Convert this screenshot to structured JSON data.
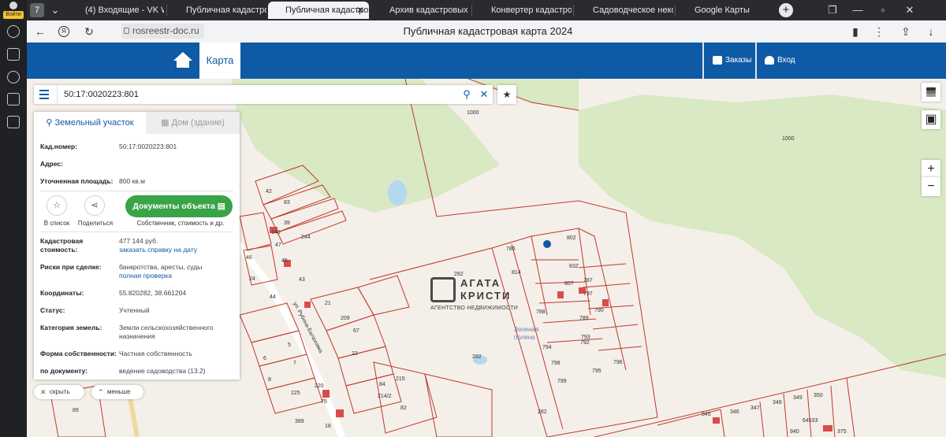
{
  "browser": {
    "user_button": "Войти",
    "tab_count": "7",
    "tabs": [
      {
        "label": "(4) Входящие - VK Wo",
        "color": "#2a7de1"
      },
      {
        "label": "Публичная кадастро",
        "color": "#45b96b"
      },
      {
        "label": "Публичная кадастро",
        "color": "#1976d2"
      },
      {
        "label": "Архив кадастровых п",
        "color": "#3f5fb5"
      },
      {
        "label": "Конвертер кадастров",
        "color": "#3f5fb5"
      },
      {
        "label": "Садоводческое неком",
        "color": "#e04436"
      },
      {
        "label": "Google Карты",
        "color": "#34a853"
      }
    ],
    "url": "rosreestr-doc.ru",
    "page_title": "Публичная кадастровая карта 2024"
  },
  "header": {
    "map_tab": "Карта",
    "orders": "Заказы",
    "login": "Вход"
  },
  "search": {
    "value": "50:17:0020223:801"
  },
  "panel": {
    "tab_land": "Земельный участок",
    "tab_house": "Дом (здание)",
    "cad_number_label": "Кад.номер:",
    "cad_number_value": "50:17:0020223:801",
    "address_label": "Адрес:",
    "area_label": "Уточненная площадь:",
    "area_value": "800 кв.м",
    "to_list": "В список",
    "share": "Поделиться",
    "docs_button": "Документы объекта",
    "docs_sub": "Собственник, стоимость и др.",
    "cost_label": "Кадастровая стоимость:",
    "cost_value": "477 144 руб.",
    "cost_link": "заказать справку на дату",
    "risk_label": "Риски при сделке:",
    "risk_value": "банкротства, аресты, суды",
    "risk_link": "полная проверка",
    "coords_label": "Координаты:",
    "coords_value": "55.820282, 38.661204",
    "status_label": "Статус:",
    "status_value": "Учтенный",
    "category_label": "Категория земель:",
    "category_value": "Земли сельскохозяйственного назначения",
    "ownership_label": "Форма собственности:",
    "ownership_value": "Частная собственность",
    "by_doc_label": "по документу:",
    "by_doc_value": "ведение садоводства (13.2)"
  },
  "pills": {
    "hide": "скрыть",
    "less": "меньше"
  },
  "map": {
    "watermark_line1": "АГАТА",
    "watermark_line2": "КРИСТИ",
    "watermark_sub": "АГЕНТСТВО НЕДВИЖИМОСТИ",
    "place_label": "Зеленая поляна",
    "plot_numbers": [
      "1000",
      "1000",
      "282",
      "282",
      "282",
      "802",
      "832",
      "786",
      "814",
      "807",
      "787",
      "797",
      "790",
      "788",
      "789",
      "793",
      "794",
      "792",
      "798",
      "795",
      "796",
      "799",
      "42",
      "83",
      "39",
      "244",
      "140",
      "47",
      "45",
      "46",
      "24",
      "43",
      "44",
      "21",
      "209",
      "67",
      "22",
      "5",
      "7",
      "6",
      "8",
      "225",
      "220",
      "389",
      "18",
      "75",
      "84",
      "214/2",
      "215",
      "82",
      "89",
      "845",
      "346",
      "347",
      "348",
      "349",
      "350",
      "64533",
      "940",
      "375"
    ],
    "street_label": "ул. Рубина-Балаховка"
  },
  "colors": {
    "brand": "#0f5aa5",
    "green_button": "#39a447",
    "plot_line": "#c0392b",
    "forest": "#d8e9c4"
  }
}
